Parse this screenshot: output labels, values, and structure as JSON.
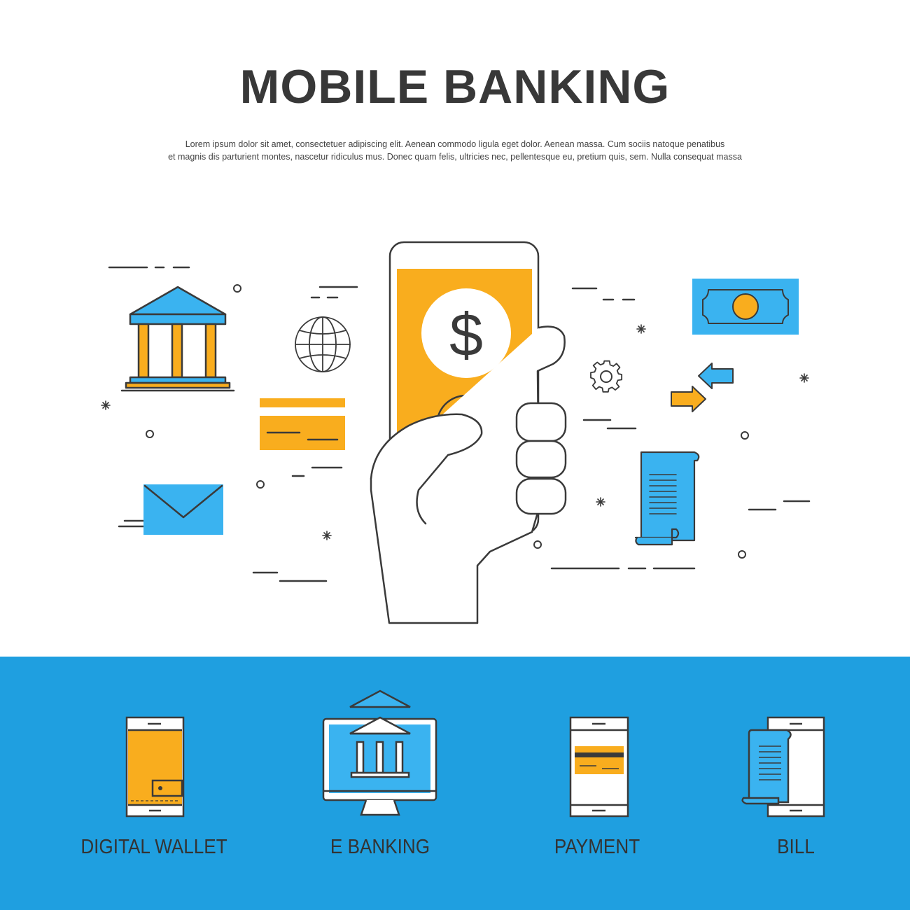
{
  "header": {
    "title": "MOBILE BANKING",
    "description_line1": "Lorem ipsum dolor sit amet, consectetuer adipiscing elit. Aenean commodo ligula eget dolor. Aenean massa. Cum sociis natoque penatibus",
    "description_line2": "et magnis dis parturient montes, nascetur ridiculus mus. Donec quam felis, ultricies nec, pellentesque eu, pretium quis, sem. Nulla consequat massa"
  },
  "hero": {
    "phone_symbol": "$",
    "icons": [
      "bank-icon",
      "globe-icon",
      "credit-card-icon",
      "envelope-icon",
      "gear-icon",
      "banknote-icon",
      "exchange-arrows-icon",
      "receipt-icon",
      "hand-holding-phone-icon"
    ]
  },
  "features": [
    {
      "label": "DIGITAL WALLET",
      "icon": "phone-wallet-icon"
    },
    {
      "label": "E BANKING",
      "icon": "monitor-bank-icon"
    },
    {
      "label": "PAYMENT",
      "icon": "phone-card-icon"
    },
    {
      "label": "BILL",
      "icon": "phone-bill-icon"
    }
  ],
  "colors": {
    "accent_orange": "#f9ad1e",
    "accent_blue": "#3ab3f0",
    "band_blue": "#1f9fe0",
    "outline": "#3a3a3a"
  }
}
